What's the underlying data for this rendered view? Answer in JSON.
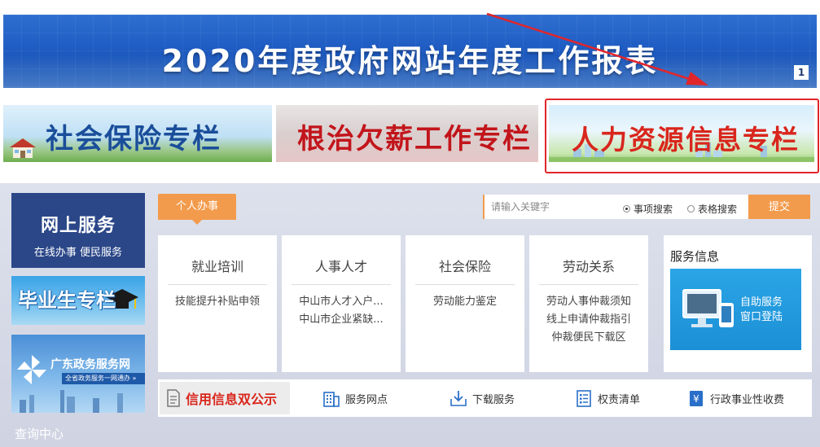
{
  "banner": {
    "title": "2020年度政府网站年度工作报表",
    "page_number": "1"
  },
  "topics": {
    "social_insurance": "社会保险专栏",
    "wage_arrears": "根治欠薪工作专栏",
    "hr_info": "人力资源信息专栏"
  },
  "sidebar": {
    "online_title": "网上服务",
    "online_subtitle": "在线办事 便民服务",
    "graduates": "毕业生专栏",
    "gd_service_name": "广东政务服务网",
    "gd_service_tagline": "全省政务服务一网通办 »",
    "query_center": "查询中心"
  },
  "tabs": {
    "personal": "个人办事"
  },
  "search": {
    "placeholder": "请输入关键字",
    "option_item": "事项搜索",
    "option_form": "表格搜索",
    "submit": "提交"
  },
  "cards": [
    {
      "title": "就业培训",
      "items": [
        "技能提升补贴申领"
      ]
    },
    {
      "title": "人事人才",
      "items": [
        "中山市人才入户...",
        "中山市企业紧缺..."
      ]
    },
    {
      "title": "社会保险",
      "items": [
        "劳动能力鉴定"
      ]
    },
    {
      "title": "劳动关系",
      "items": [
        "劳动人事仲裁须知",
        "线上申请仲裁指引",
        "仲裁便民下载区"
      ]
    }
  ],
  "service_info": {
    "title": "服务信息",
    "self_service_line1": "自助服务",
    "self_service_line2": "窗口登陆"
  },
  "bottom": {
    "credit": "信用信息双公示",
    "outlets": "服务网点",
    "downloads": "下载服务",
    "power_list": "权责清单",
    "fees": "行政事业性收费"
  },
  "colors": {
    "banner_blue": "#1f5cc3",
    "orange": "#f39b4c",
    "navy": "#2b4788",
    "highlight_red": "#e0262b"
  }
}
